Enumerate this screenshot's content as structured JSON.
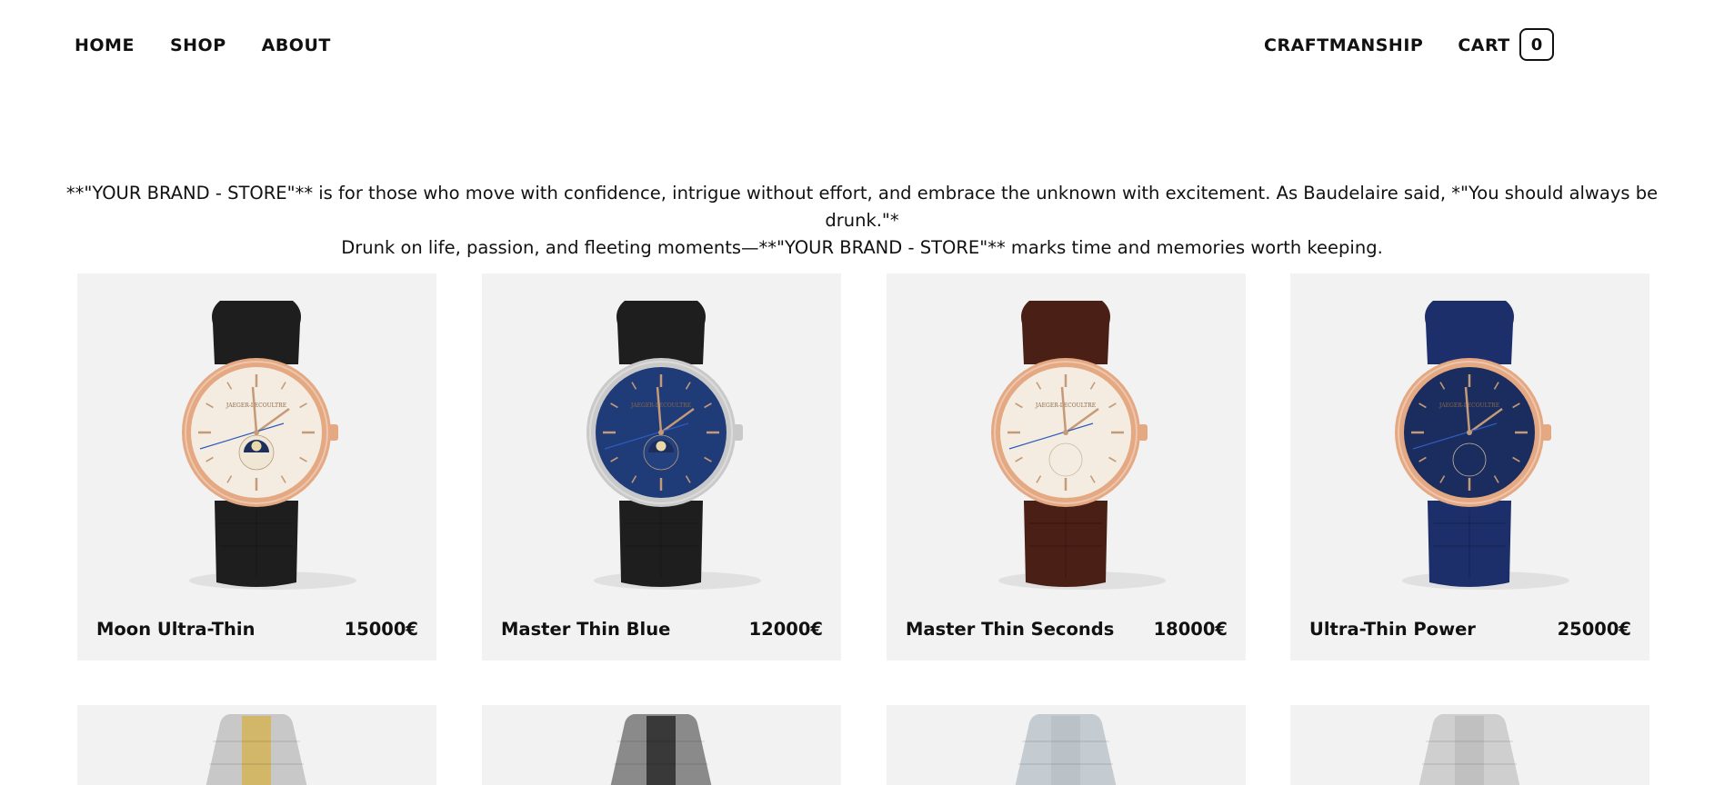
{
  "nav": {
    "left": [
      "HOME",
      "SHOP",
      "ABOUT"
    ],
    "right": [
      "CRAFTMANSHIP",
      "CART"
    ],
    "cart_count": "0"
  },
  "intro": {
    "line1": "**\"YOUR BRAND - STORE\"** is for those who move with confidence, intrigue without effort, and embrace the unknown with excitement. As Baudelaire said, *\"You should always be drunk.\"*",
    "line2": "Drunk on life, passion, and fleeting moments—**\"YOUR BRAND - STORE\"** marks time and memories worth keeping."
  },
  "products": [
    {
      "name": "Moon Ultra-Thin",
      "price": "15000€",
      "case": "#e4a882",
      "dial": "#f4ece0",
      "strap": "#1e1e1e",
      "moon": true
    },
    {
      "name": "Master Thin Blue",
      "price": "12000€",
      "case": "#c9c9c9",
      "dial": "#1f3b78",
      "strap": "#1e1e1e",
      "moon": true
    },
    {
      "name": "Master Thin Seconds",
      "price": "18000€",
      "case": "#e4a882",
      "dial": "#f4ece0",
      "strap": "#4a1f16",
      "moon": false
    },
    {
      "name": "Ultra-Thin Power",
      "price": "25000€",
      "case": "#e4a882",
      "dial": "#1a2d5e",
      "strap": "#1d2f6a",
      "moon": false
    }
  ],
  "products_row2": [
    {
      "bracelet": "#c8c8c8",
      "accent": "#d4b458"
    },
    {
      "bracelet": "#8a8a8a",
      "accent": "#2a2a2a"
    },
    {
      "bracelet": "#c4ccd2",
      "accent": "#b8c0c6"
    },
    {
      "bracelet": "#cfcfcf",
      "accent": "#bdbdbd"
    }
  ]
}
